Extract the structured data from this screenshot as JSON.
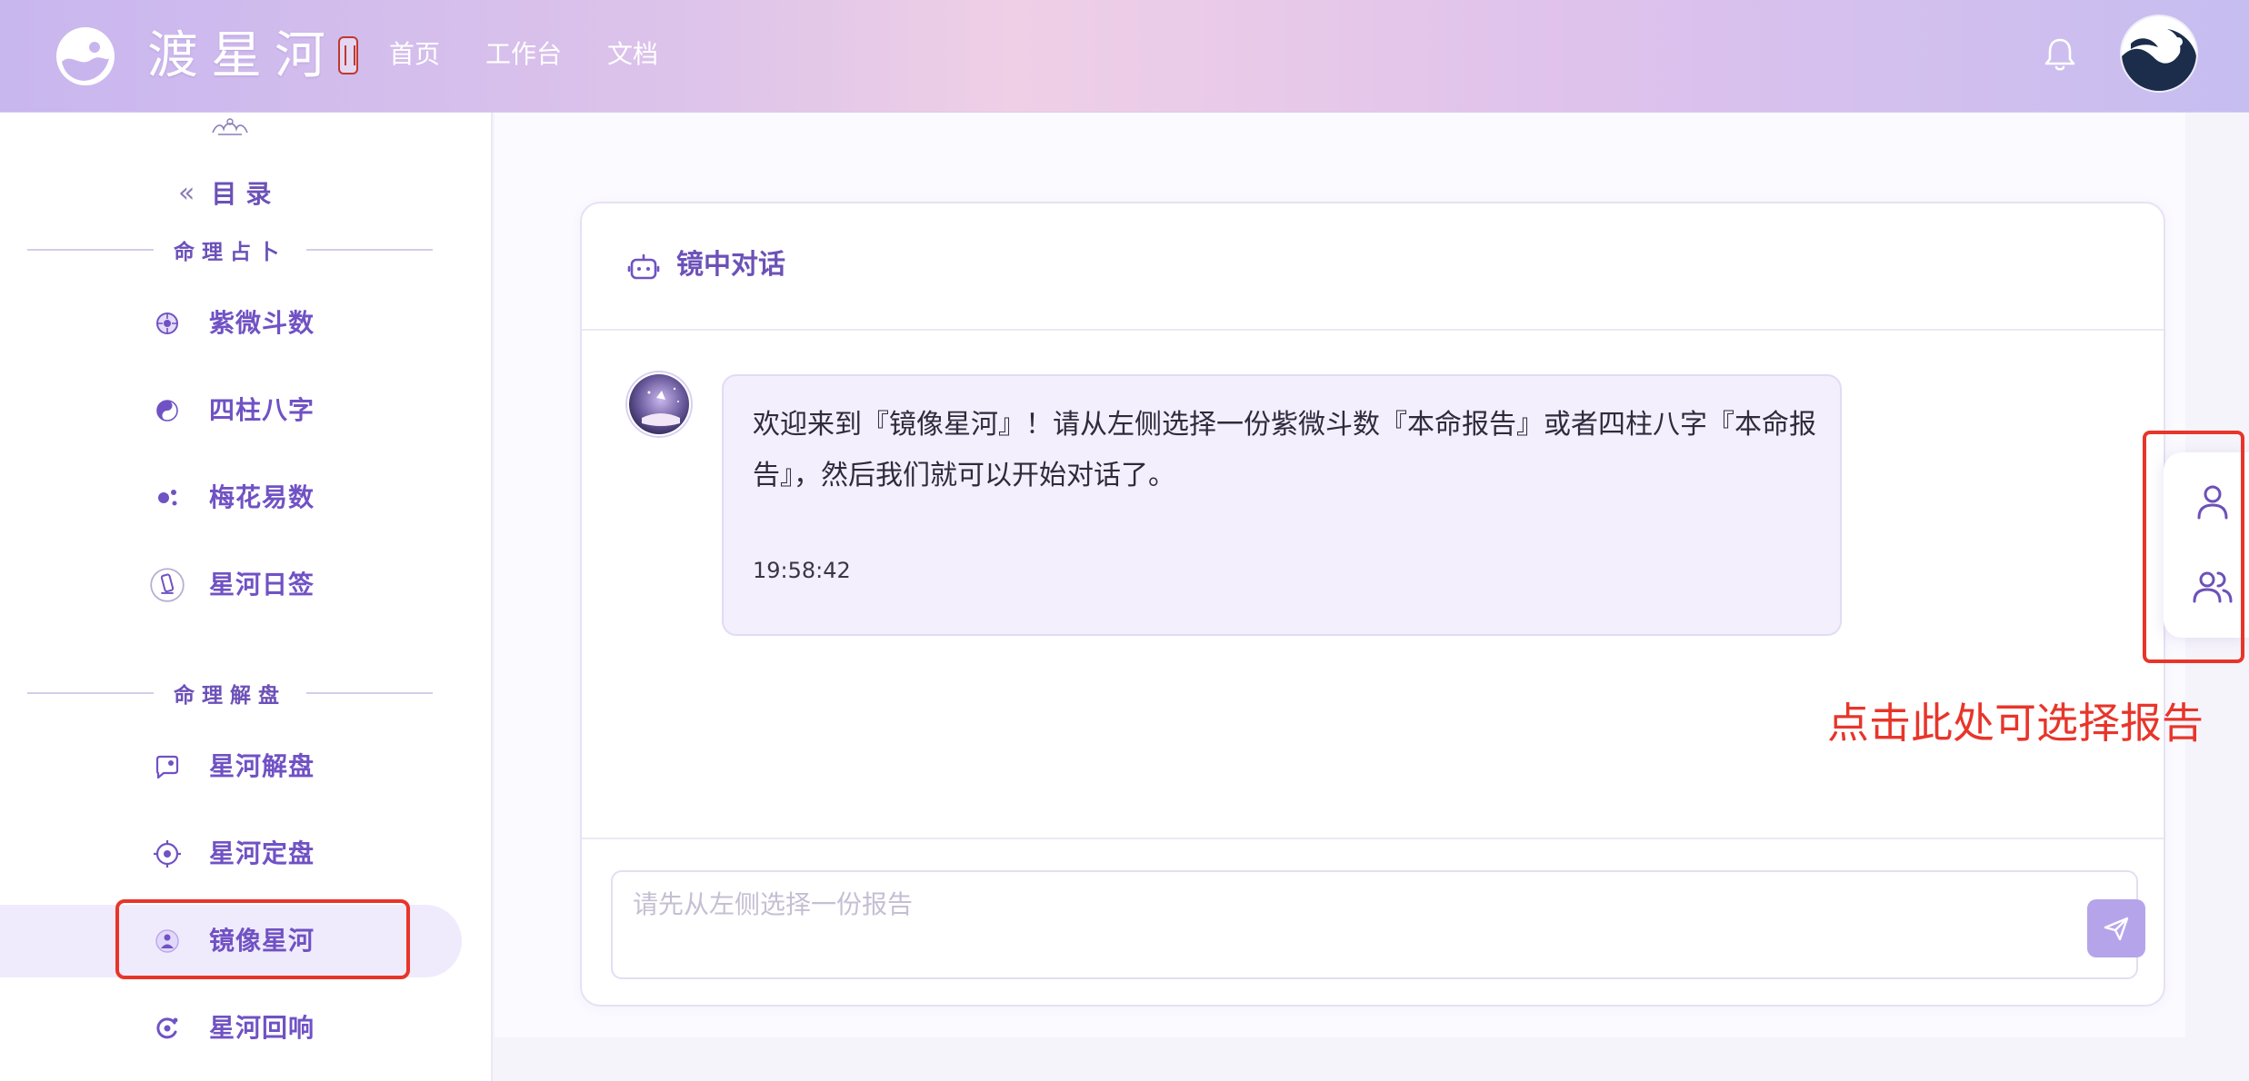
{
  "header": {
    "brand": "渡星河",
    "nav": [
      "首页",
      "工作台",
      "文档"
    ]
  },
  "sidebar": {
    "toc_label": "目录",
    "toc_chevron": "«",
    "sections": [
      {
        "title": "命理占卜",
        "items": [
          {
            "label": "紫微斗数",
            "icon": "ziwei-icon"
          },
          {
            "label": "四柱八字",
            "icon": "bazi-icon"
          },
          {
            "label": "梅花易数",
            "icon": "meihua-icon"
          },
          {
            "label": "星河日签",
            "icon": "daily-sign-icon"
          }
        ]
      },
      {
        "title": "命理解盘",
        "items": [
          {
            "label": "星河解盘",
            "icon": "chart-reading-icon"
          },
          {
            "label": "星河定盘",
            "icon": "target-icon"
          },
          {
            "label": "镜像星河",
            "icon": "mirror-icon",
            "active": true
          },
          {
            "label": "星河回响",
            "icon": "echo-icon"
          }
        ]
      }
    ]
  },
  "chat": {
    "title": "镜中对话",
    "message": {
      "text": "欢迎来到『镜像星河』！请从左侧选择一份紫微斗数『本命报告』或者四柱八字『本命报告』，然后我们就可以开始对话了。",
      "time": "19:58:42"
    },
    "input_placeholder": "请先从左侧选择一份报告"
  },
  "annotation": "点击此处可选择报告",
  "colors": {
    "accent": "#6c51b8",
    "highlight": "#e8352a",
    "send_button": "#b6a4ea"
  }
}
